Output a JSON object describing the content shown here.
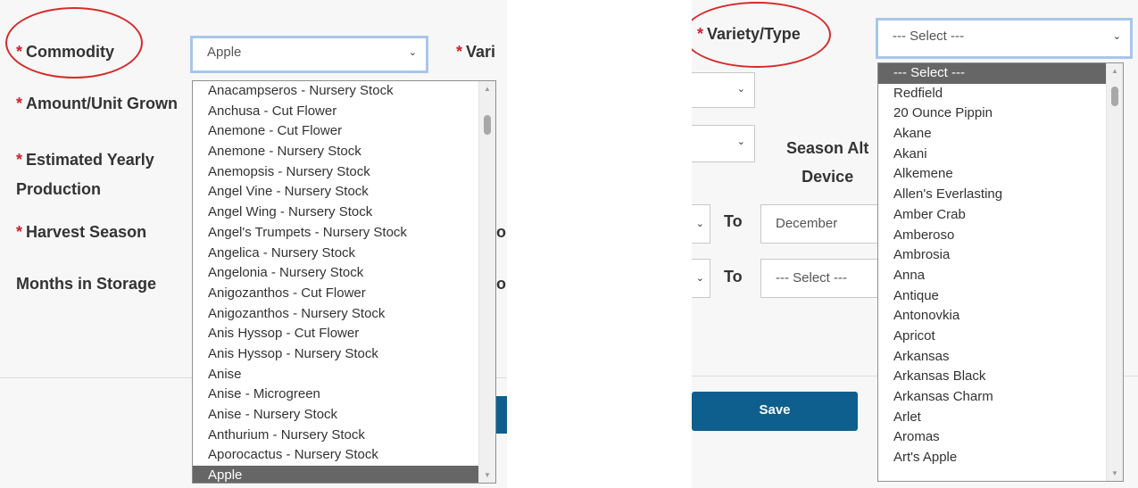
{
  "colors": {
    "required": "#d0202a",
    "annotation": "#d62a2a",
    "button": "#0e5f8d",
    "selected_bg": "#666666",
    "focus_border": "#a8c6ec"
  },
  "left": {
    "required_marker": "*",
    "labels": {
      "commodity": "Commodity",
      "variety_truncated": "Vari",
      "amount_unit_grown": "Amount/Unit Grown",
      "estimated_yearly_line1": "Estimated Yearly",
      "estimated_yearly_line2": "Production",
      "harvest_season": "Harvest Season",
      "months_in_storage": "Months in Storage",
      "to_truncated": "o"
    },
    "commodity_select": {
      "value": "Apple",
      "chevron": "chevron-down-icon"
    },
    "commodity_options": [
      "Anacampseros - Nursery Stock",
      "Anchusa - Cut Flower",
      "Anemone - Cut Flower",
      "Anemone - Nursery Stock",
      "Anemopsis - Nursery Stock",
      "Angel Vine - Nursery Stock",
      "Angel Wing - Nursery Stock",
      "Angel's Trumpets - Nursery Stock",
      "Angelica - Nursery Stock",
      "Angelonia - Nursery Stock",
      "Anigozanthos - Cut Flower",
      "Anigozanthos - Nursery Stock",
      "Anis Hyssop - Cut Flower",
      "Anis Hyssop - Nursery Stock",
      "Anise",
      "Anise - Microgreen",
      "Anise - Nursery Stock",
      "Anthurium - Nursery Stock",
      "Aporocactus - Nursery Stock",
      "Apple"
    ],
    "selected_option": "Apple"
  },
  "right": {
    "required_marker": "*",
    "labels": {
      "variety_type": "Variety/Type",
      "season_alt_line1": "Season Alt",
      "season_alt_line2": "Device",
      "to1": "To",
      "to2": "To"
    },
    "variety_select": {
      "value": "--- Select ---",
      "chevron": "chevron-down-icon"
    },
    "harvest_to_select": {
      "value": "December"
    },
    "storage_to_select": {
      "value": "--- Select ---"
    },
    "save_button": "Save",
    "variety_options": [
      "--- Select ---",
      "Redfield",
      "20 Ounce Pippin",
      "Akane",
      "Akani",
      "Alkemene",
      "Allen's Everlasting",
      "Amber Crab",
      "Amberoso",
      "Ambrosia",
      "Anna",
      "Antique",
      "Antonovkia",
      "Apricot",
      "Arkansas",
      "Arkansas Black",
      "Arkansas Charm",
      "Arlet",
      "Aromas",
      "Art's Apple"
    ],
    "selected_option": "--- Select ---"
  }
}
